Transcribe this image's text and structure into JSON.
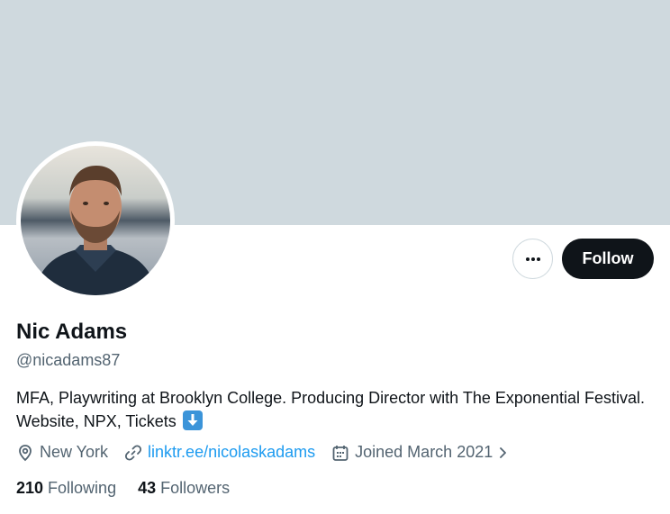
{
  "colors": {
    "banner": "#cfd9de",
    "text_primary": "#0f1419",
    "text_secondary": "#536471",
    "link": "#1d9bf0",
    "follow_button_bg": "#0f1419"
  },
  "profile": {
    "display_name": "Nic Adams",
    "handle": "@nicadams87",
    "bio_text": "MFA, Playwriting at Brooklyn College. Producing Director with The Exponential Festival. Website, NPX, Tickets",
    "bio_emoji_icon": "down-arrow-emoji-icon",
    "location": "New York",
    "website": "linktr.ee/nicolaskadams",
    "joined": "Joined March 2021"
  },
  "actions": {
    "more_icon": "more-horizontal-icon",
    "follow_label": "Follow"
  },
  "stats": {
    "following_count": "210",
    "following_label": "Following",
    "followers_count": "43",
    "followers_label": "Followers"
  },
  "icons": {
    "location": "location-pin-icon",
    "website": "link-icon",
    "joined": "calendar-icon",
    "joined_more": "chevron-right-icon"
  }
}
